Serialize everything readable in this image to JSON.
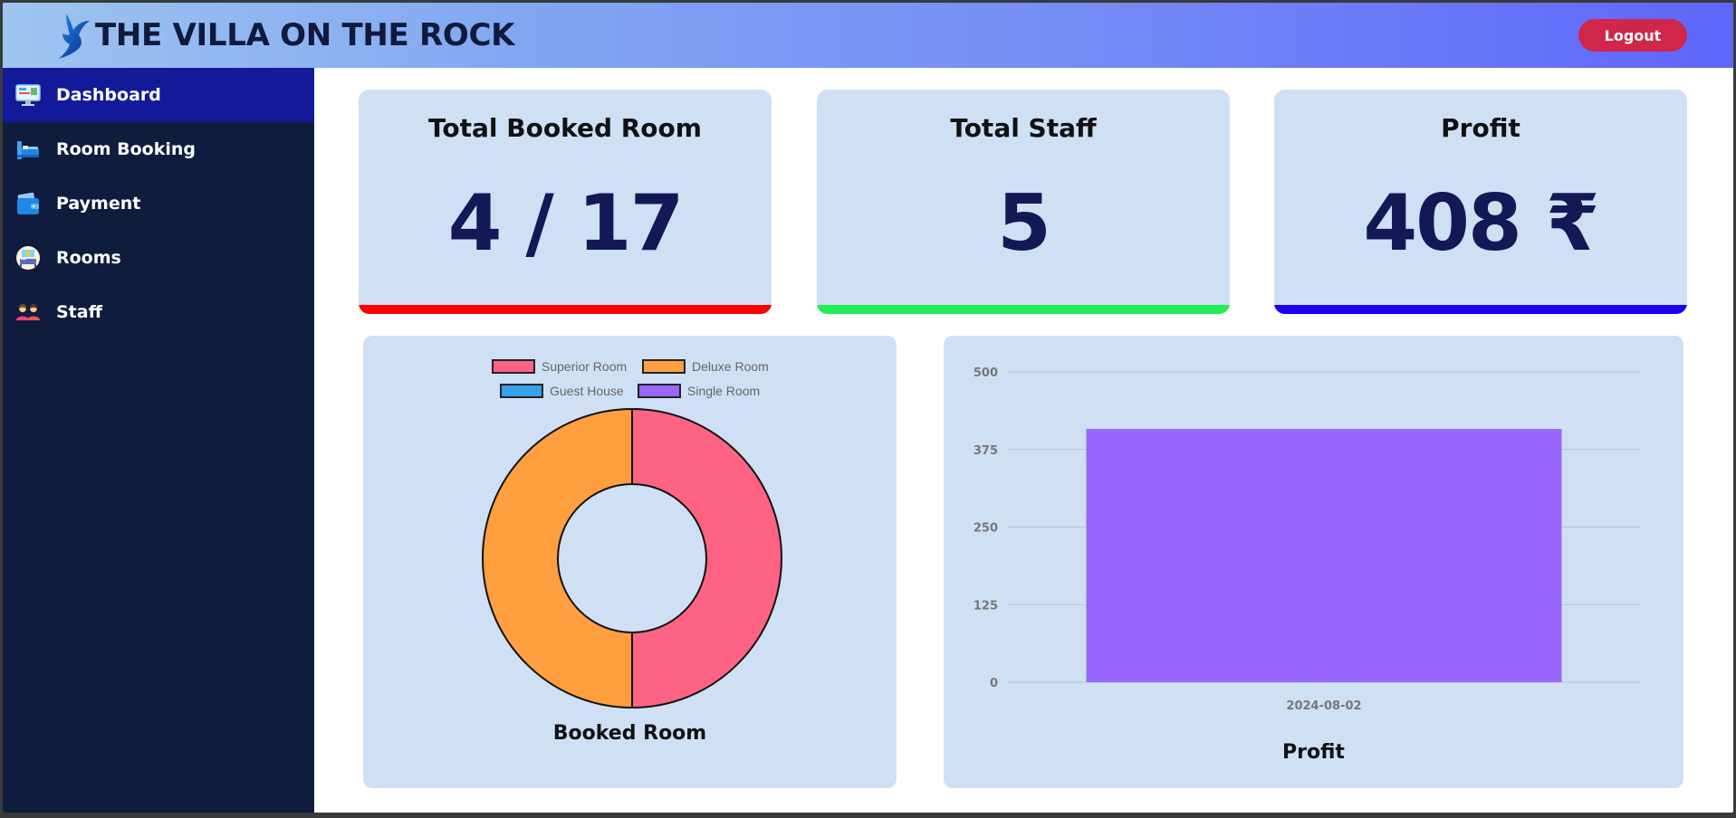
{
  "app": {
    "title": "THE VILLA ON THE ROCK",
    "logout_label": "Logout"
  },
  "sidebar": {
    "items": [
      {
        "label": "Dashboard",
        "icon": "monitor-icon",
        "active": true
      },
      {
        "label": "Room Booking",
        "icon": "bed-icon",
        "active": false
      },
      {
        "label": "Payment",
        "icon": "wallet-icon",
        "active": false
      },
      {
        "label": "Rooms",
        "icon": "room-icon",
        "active": false
      },
      {
        "label": "Staff",
        "icon": "staff-icon",
        "active": false
      }
    ]
  },
  "cards": [
    {
      "title": "Total Booked Room",
      "value": "4 / 17",
      "accent": "#ff0000"
    },
    {
      "title": "Total Staff",
      "value": "5",
      "accent": "#22ee55"
    },
    {
      "title": "Profit",
      "value": "408 ₹",
      "accent": "#1a00f0"
    }
  ],
  "colors": {
    "sidebar_bg": "#0f1c3e",
    "sidebar_active": "#131a9a",
    "card_bg": "#cfe0f4",
    "logout_bg": "#d0264a",
    "value_text": "#151856"
  },
  "chart_data": [
    {
      "type": "pie",
      "title": "Booked Room",
      "legend_position": "top",
      "categories": [
        "Superior Room",
        "Deluxe Room",
        "Guest House",
        "Single Room"
      ],
      "values": [
        2,
        2,
        0,
        0
      ],
      "colors": [
        "#ff6384",
        "#ff9f40",
        "#36a2eb",
        "#9966ff"
      ]
    },
    {
      "type": "bar",
      "title": "Profit",
      "categories": [
        "2024-08-02"
      ],
      "values": [
        408
      ],
      "ylim": [
        0,
        500
      ],
      "yticks": [
        "0",
        "125",
        "250",
        "375",
        "500"
      ],
      "grid": true,
      "color": "#9966ff"
    }
  ]
}
